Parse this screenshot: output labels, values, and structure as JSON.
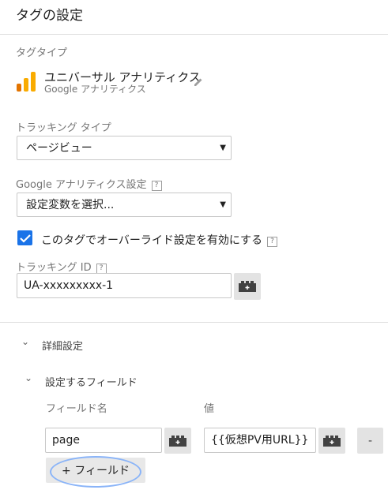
{
  "header": {
    "title": "タグの設定"
  },
  "tag_type": {
    "section_label": "タグタイプ",
    "name": "ユニバーサル アナリティクス",
    "subtitle": "Google アナリティクス",
    "icon": "google-analytics-icon",
    "edit_icon": "pencil-icon"
  },
  "tracking_type": {
    "label": "トラッキング タイプ",
    "value": "ページビュー"
  },
  "ga_settings": {
    "label": "Google アナリティクス設定",
    "help": "?",
    "value": "設定変数を選択..."
  },
  "override": {
    "label": "このタグでオーバーライド設定を有効にする",
    "help": "?",
    "checked": true
  },
  "tracking_id": {
    "label": "トラッキング ID",
    "help": "?",
    "value": "UA-xxxxxxxxx-1"
  },
  "advanced": {
    "label": "詳細設定",
    "fields_section": {
      "label": "設定するフィールド",
      "col_name": "フィールド名",
      "col_value": "値",
      "rows": [
        {
          "name": "page",
          "value": "{{仮想PV用URL}}"
        }
      ],
      "remove_label": "-",
      "add_label": "+ フィールド"
    }
  },
  "colors": {
    "accent": "#1a73e8",
    "ga_orange": "#f9ab00",
    "ga_dark_orange": "#e37400"
  }
}
